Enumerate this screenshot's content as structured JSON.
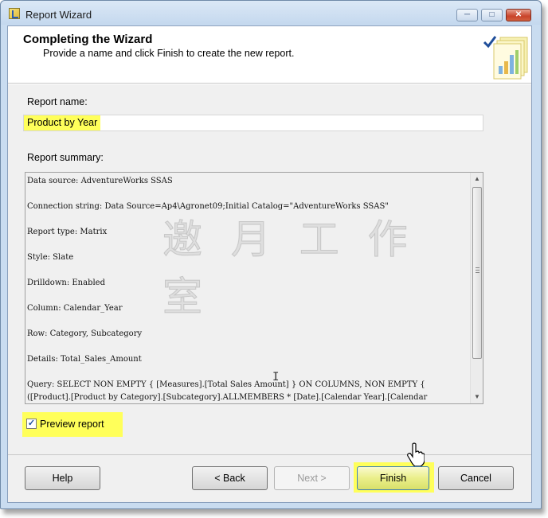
{
  "window": {
    "title": "Report Wizard",
    "controls": {
      "minimize": "─",
      "maximize": "□",
      "close": "✕"
    }
  },
  "header": {
    "title": "Completing the Wizard",
    "subtitle": "Provide a name and click Finish to create the new report.",
    "graphic_icon": "wizard-report-chart-icon"
  },
  "report_name": {
    "label": "Report name:",
    "value": "Product by Year"
  },
  "report_summary": {
    "label": "Report summary:",
    "lines": [
      "Data source: AdventureWorks SSAS",
      "Connection string: Data Source=Ap4\\Agronet09;Initial Catalog=\"AdventureWorks SSAS\"",
      "Report type: Matrix",
      "Style: Slate",
      "Drilldown: Enabled",
      "Column: Calendar_Year",
      "Row: Category, Subcategory",
      "Details: Total_Sales_Amount",
      "Query:  SELECT NON EMPTY { [Measures].[Total Sales Amount] } ON COLUMNS, NON EMPTY {",
      "([Product].[Product by Category].[Subcategory].ALLMEMBERS * [Date].[Calendar Year].[Calendar"
    ],
    "watermark": "邀 月 工 作 室"
  },
  "preview": {
    "label": "Preview report",
    "checked": true
  },
  "buttons": {
    "help": "Help",
    "back": "< Back",
    "next": "Next >",
    "finish": "Finish",
    "cancel": "Cancel"
  },
  "colors": {
    "highlight": "#ffff5a",
    "titlebar": "#c9dcf0",
    "close_button": "#c9432a"
  }
}
